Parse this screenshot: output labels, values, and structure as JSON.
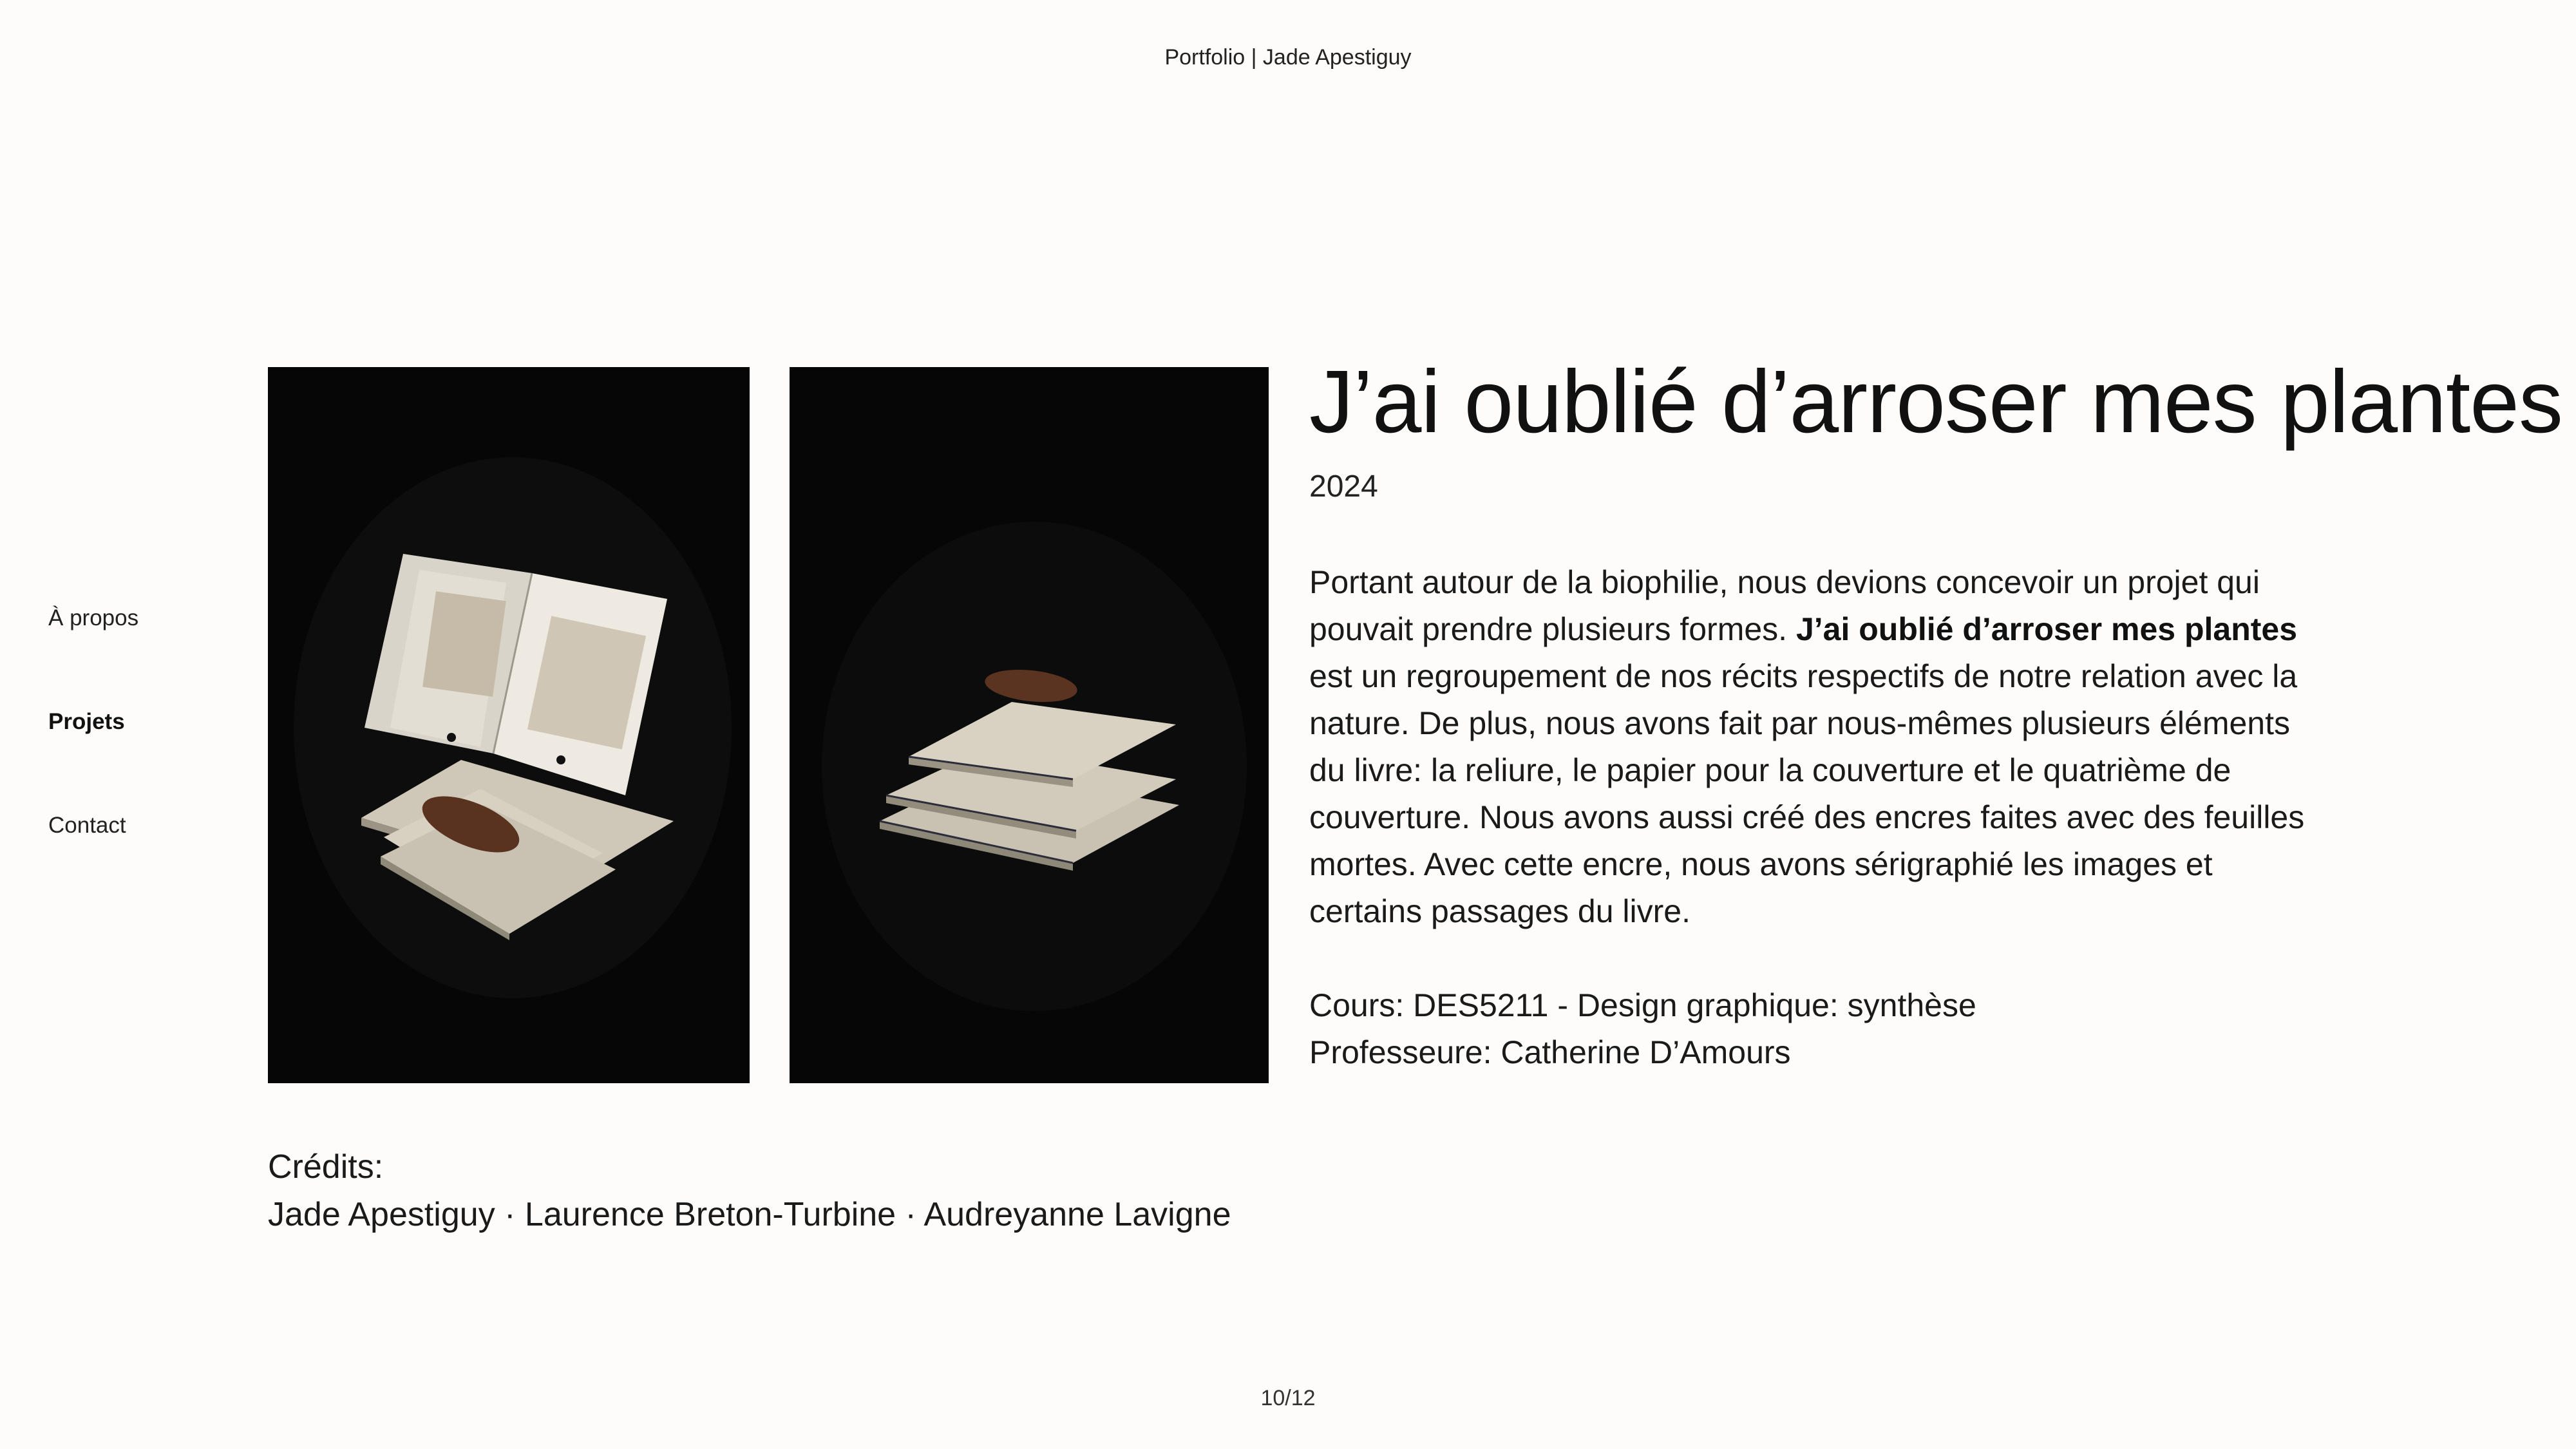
{
  "header": {
    "site_title": "Portfolio | Jade Apestiguy"
  },
  "nav": {
    "items": [
      {
        "label": "À propos",
        "active": false
      },
      {
        "label": "Projets",
        "active": true
      },
      {
        "label": "Contact",
        "active": false
      }
    ]
  },
  "project": {
    "title": "J’ai oublié d’arroser mes plantes",
    "year": "2024",
    "description_intro": "Portant autour de la biophilie, nous devions concevoir un projet qui pouvait prendre plusieurs formes.",
    "description_bold": "J’ai oublié d’arroser mes plantes",
    "description_rest": "est un regroupement de nos récits respectifs de notre relation avec la nature. De plus, nous avons fait par nous-mêmes plusieurs éléments du livre: la reliure, le papier pour la couverture et le quatrième de couverture. Nous avons aussi créé des encres faites avec des feuilles mortes. Avec cette encre, nous avons sérigraphié les images et certains passages du livre.",
    "course": "Cours: DES5211 - Design graphique: synthèse",
    "professor": "Professeure: Catherine D’Amours",
    "credits_label": "Crédits:",
    "credits": "Jade Apestiguy · Laurence Breton-Turbine · Audreyanne Lavigne",
    "images": [
      {
        "icon": "open-book-photo"
      },
      {
        "icon": "stacked-books-photo"
      }
    ]
  },
  "pagination": {
    "current": "10/12"
  },
  "colors": {
    "background": "#fdfcfa",
    "photo_background": "#050505",
    "text": "#111111"
  }
}
